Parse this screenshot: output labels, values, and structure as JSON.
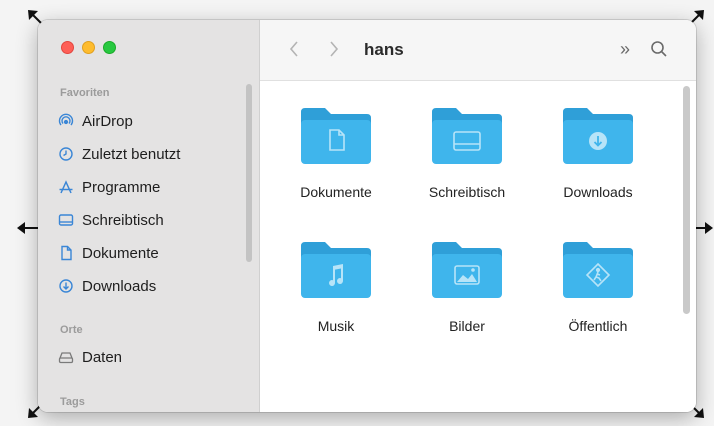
{
  "window": {
    "title": "hans",
    "toolbar": {
      "more_glyph": "»"
    }
  },
  "sidebar": {
    "sections": [
      {
        "label": "Favoriten",
        "items": [
          {
            "label": "AirDrop",
            "icon": "airdrop-icon"
          },
          {
            "label": "Zuletzt benutzt",
            "icon": "clock-icon"
          },
          {
            "label": "Programme",
            "icon": "apps-icon"
          },
          {
            "label": "Schreibtisch",
            "icon": "desktop-icon"
          },
          {
            "label": "Dokumente",
            "icon": "document-icon"
          },
          {
            "label": "Downloads",
            "icon": "download-icon"
          }
        ]
      },
      {
        "label": "Orte",
        "items": [
          {
            "label": "Daten",
            "icon": "drive-icon"
          }
        ]
      },
      {
        "label": "Tags",
        "items": []
      }
    ]
  },
  "folders": [
    {
      "label": "Dokumente",
      "icon": "document-icon"
    },
    {
      "label": "Schreibtisch",
      "icon": "desktop-icon"
    },
    {
      "label": "Downloads",
      "icon": "download-icon"
    },
    {
      "label": "Musik",
      "icon": "music-icon"
    },
    {
      "label": "Bilder",
      "icon": "image-icon"
    },
    {
      "label": "Öffentlich",
      "icon": "public-icon"
    }
  ],
  "colors": {
    "folder_body": "#3fb5ec",
    "folder_tab": "#2f9fd8",
    "folder_glyph": "#b7e4f8",
    "sidebar_icon": "#3a86d6"
  }
}
